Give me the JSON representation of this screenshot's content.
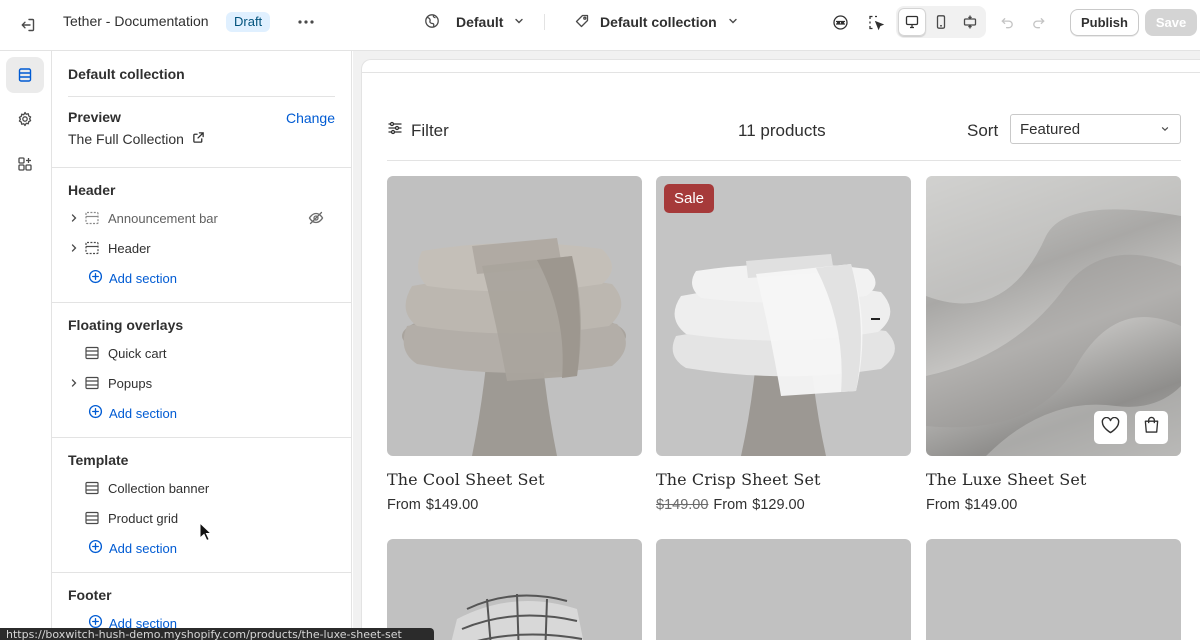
{
  "topbar": {
    "title": "Tether - Documentation",
    "status_badge": "Draft",
    "theme_selector": "Default",
    "template_selector": "Default collection",
    "publish_label": "Publish",
    "save_label": "Save",
    "icons": [
      "exit-icon",
      "more-icon",
      "globe-icon",
      "template-icon",
      "ai-assistant-icon",
      "inspector-icon",
      "desktop-icon",
      "mobile-icon",
      "fullwidth-icon",
      "undo-icon",
      "redo-icon"
    ]
  },
  "rail": {
    "items": [
      "sections-icon",
      "settings-icon",
      "apps-icon"
    ],
    "active": "sections-icon"
  },
  "sidebar": {
    "title": "Default collection",
    "preview": {
      "label": "Preview",
      "change_link": "Change",
      "value": "The Full Collection"
    },
    "groups": [
      {
        "label": "Header",
        "items": [
          {
            "label": "Announcement bar",
            "expandable": true,
            "hidden": true
          },
          {
            "label": "Header",
            "expandable": true,
            "hidden": false
          }
        ],
        "add_label": "Add section"
      },
      {
        "label": "Floating overlays",
        "items": [
          {
            "label": "Quick cart",
            "expandable": false,
            "hidden": false
          },
          {
            "label": "Popups",
            "expandable": true,
            "hidden": false
          }
        ],
        "add_label": "Add section"
      },
      {
        "label": "Template",
        "items": [
          {
            "label": "Collection banner",
            "expandable": false,
            "hidden": false
          },
          {
            "label": "Product grid",
            "expandable": false,
            "hidden": false
          }
        ],
        "add_label": "Add section"
      },
      {
        "label": "Footer",
        "items": [],
        "add_label": "Add section"
      }
    ]
  },
  "status_url": "https://boxwitch-hush-demo.myshopify.com/products/the-luxe-sheet-set",
  "preview": {
    "filter_label": "Filter",
    "product_count": "11 products",
    "sort_label": "Sort",
    "sort_value": "Featured",
    "products": [
      {
        "name": "The Cool Sheet Set",
        "price_prefix": "From",
        "price": "$149.00",
        "compare_at": "",
        "badge": ""
      },
      {
        "name": "The Crisp Sheet Set",
        "price_prefix": "From",
        "price": "$129.00",
        "compare_at": "$149.00",
        "badge": "Sale"
      },
      {
        "name": "The Luxe Sheet Set",
        "price_prefix": "From",
        "price": "$149.00",
        "compare_at": "",
        "badge": ""
      }
    ],
    "colors": {
      "sale_badge": "#a63a3a",
      "link": "#005bd3",
      "draft_badge_bg": "#e0f0ff"
    }
  }
}
